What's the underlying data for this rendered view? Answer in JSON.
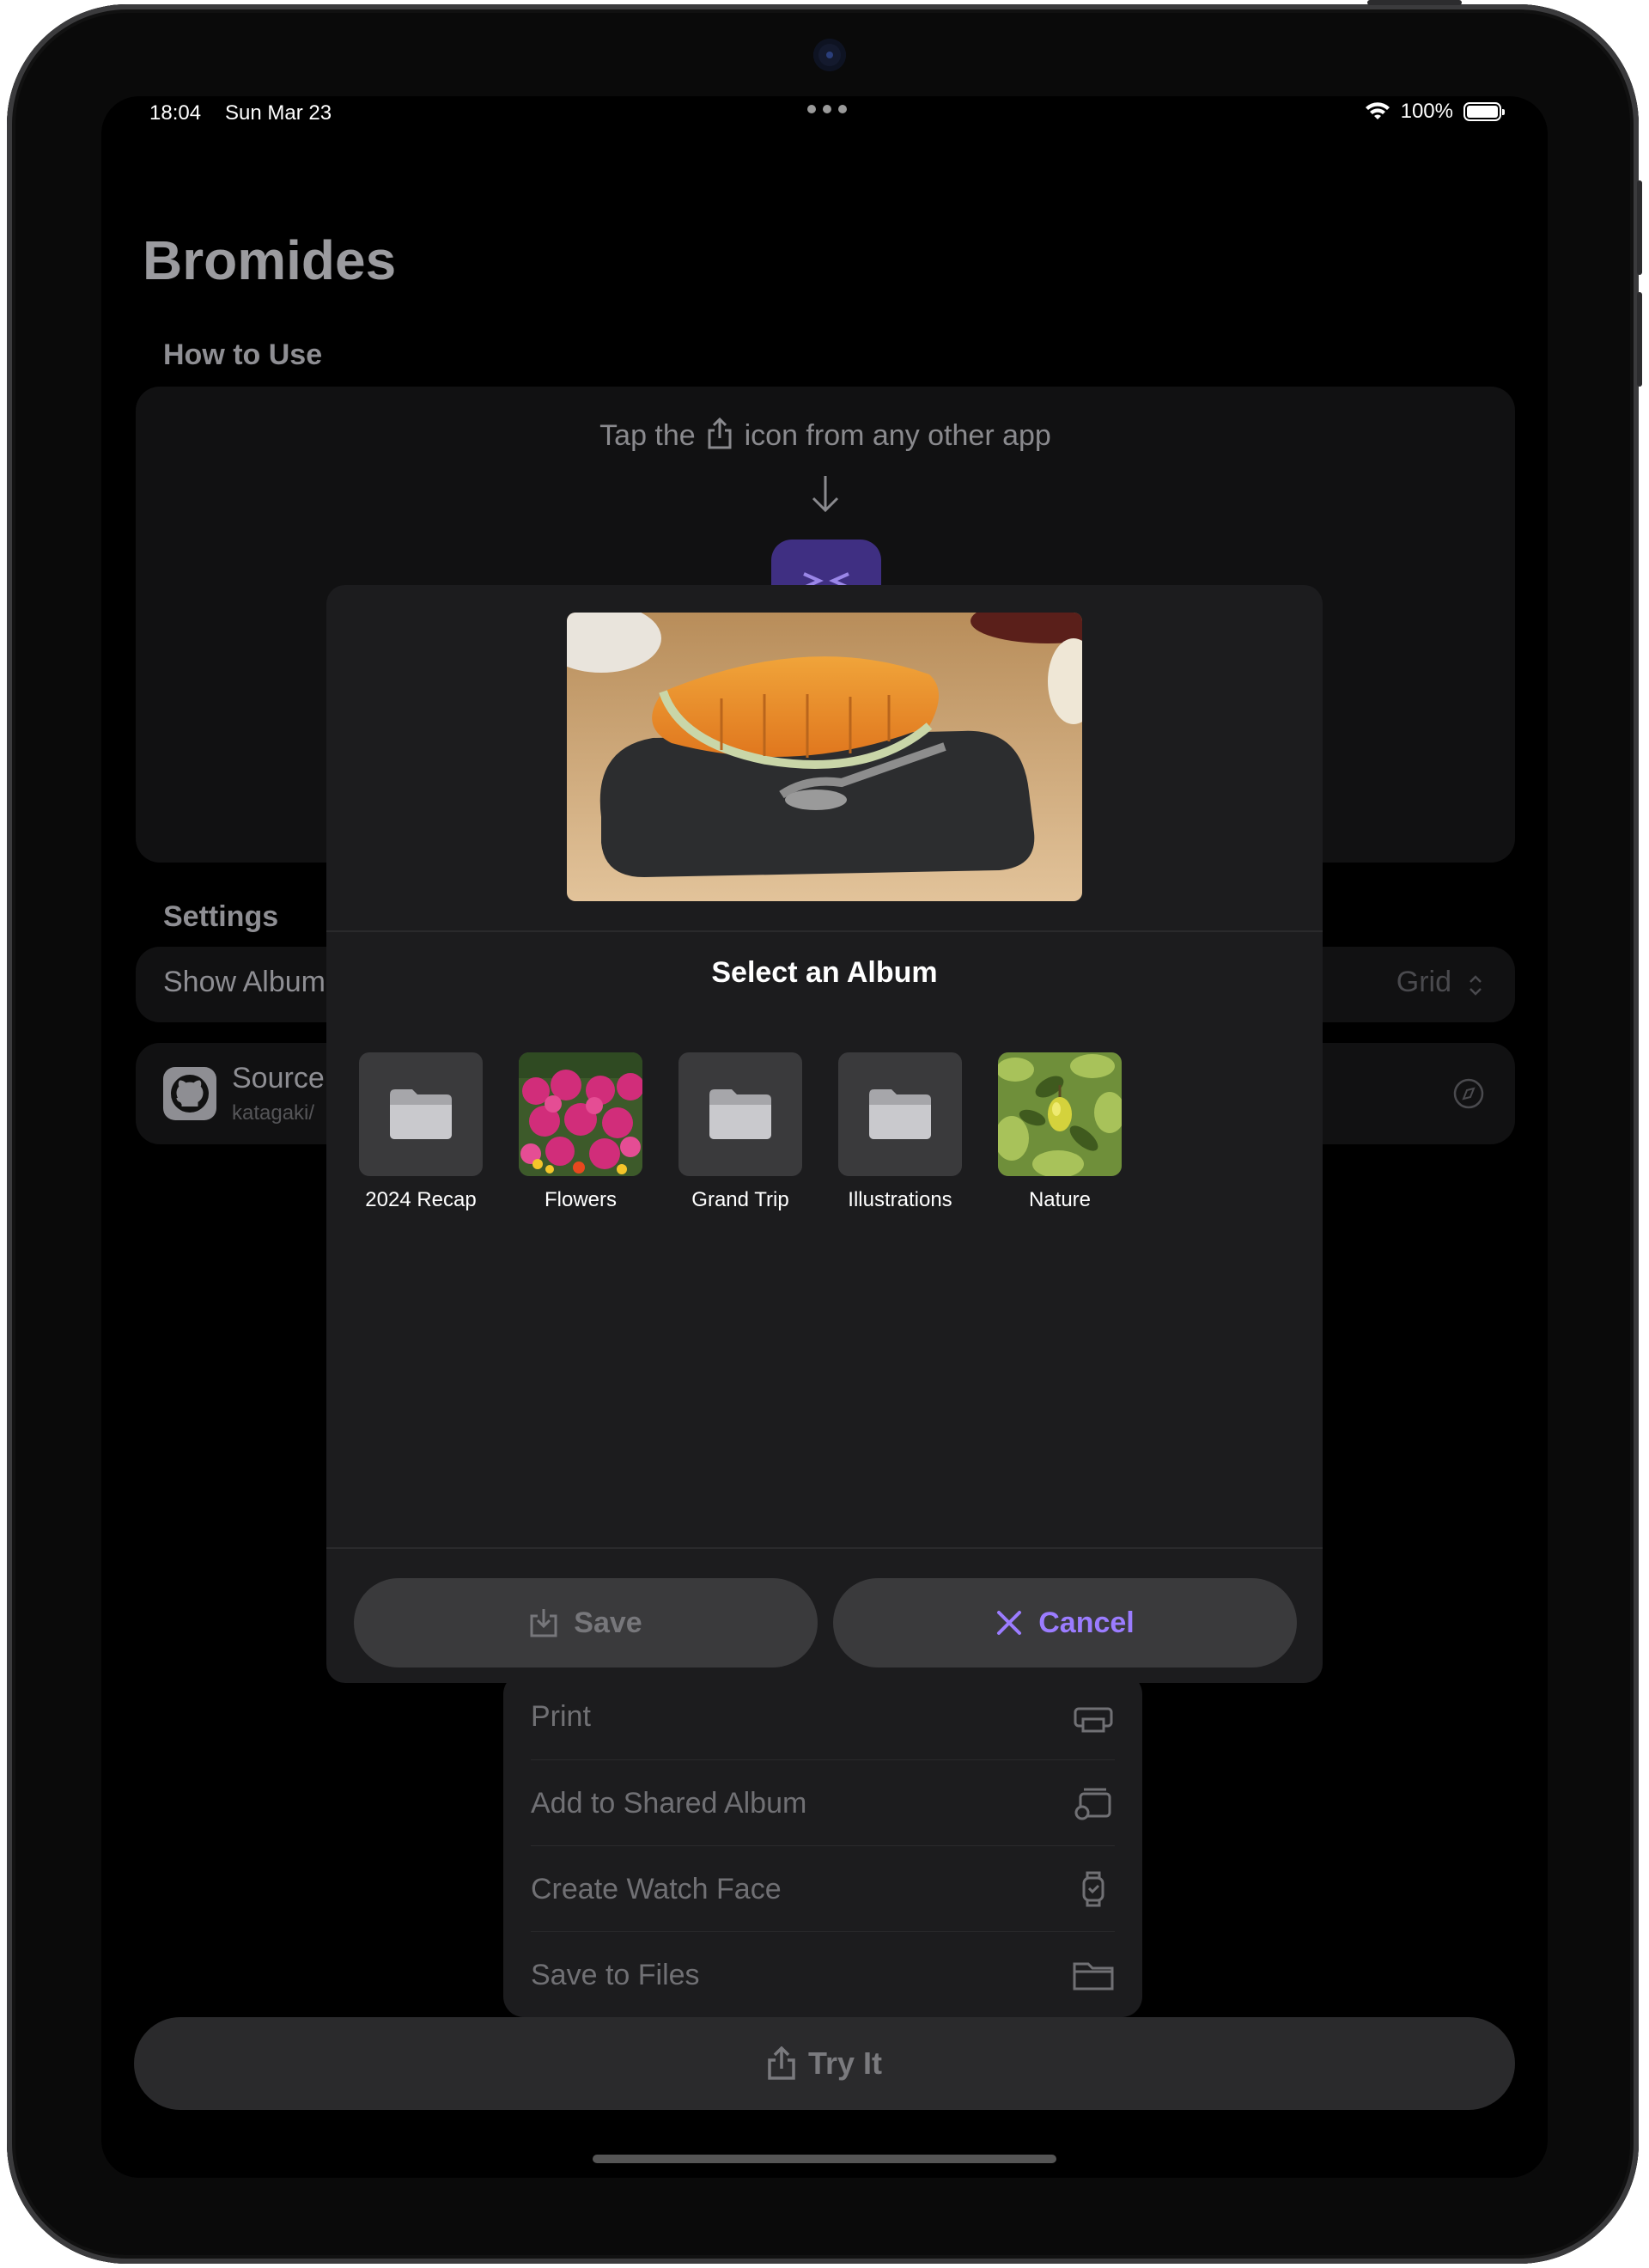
{
  "status_bar": {
    "time": "18:04",
    "date": "Sun Mar 23",
    "battery": "100%",
    "battery_level": 1.0
  },
  "app": {
    "title": "Bromides",
    "how_to_use": {
      "heading": "How to Use",
      "instruction_prefix": "Tap the",
      "instruction_suffix": "icon from any other app"
    },
    "settings": {
      "heading": "Settings",
      "show_album_label": "Show Album",
      "show_album_value": "Grid",
      "source_label": "Source",
      "source_sub": "katagaki/"
    },
    "share_menu": {
      "items": [
        {
          "label": "Print",
          "icon": "printer-icon"
        },
        {
          "label": "Add to Shared Album",
          "icon": "shared-album-icon"
        },
        {
          "label": "Create Watch Face",
          "icon": "watch-icon"
        },
        {
          "label": "Save to Files",
          "icon": "folder-icon"
        }
      ]
    },
    "try_button": "Try It"
  },
  "modal": {
    "title": "Select an Album",
    "albums": [
      {
        "name": "2024 Recap",
        "thumb": "folder-icon"
      },
      {
        "name": "Flowers",
        "thumb": "flowers-photo"
      },
      {
        "name": "Grand Trip",
        "thumb": "folder-icon"
      },
      {
        "name": "Illustrations",
        "thumb": "folder-icon"
      },
      {
        "name": "Nature",
        "thumb": "nature-photo"
      }
    ],
    "save_label": "Save",
    "cancel_label": "Cancel"
  },
  "colors": {
    "accent": "#9b7cff",
    "background": "#000000",
    "modal_bg": "#1c1c1e"
  }
}
